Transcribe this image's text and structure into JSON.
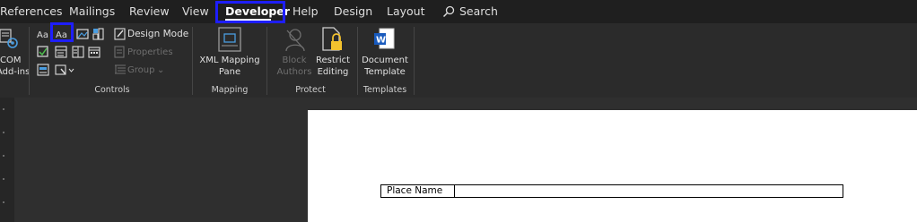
{
  "tabs": {
    "references": "References",
    "mailings": "Mailings",
    "review": "Review",
    "view": "View",
    "developer": "Developer",
    "help": "Help",
    "design": "Design",
    "layout": "Layout",
    "search": "Search"
  },
  "ribbon": {
    "addins": {
      "line1": "COM",
      "line2": "Add-ins"
    },
    "controls": {
      "design_mode": "Design Mode",
      "properties": "Properties",
      "group": "Group",
      "label": "Controls"
    },
    "mapping": {
      "line1": "XML Mapping",
      "line2": "Pane",
      "label": "Mapping"
    },
    "protect": {
      "block_line1": "Block",
      "block_line2": "Authors",
      "restrict_line1": "Restrict",
      "restrict_line2": "Editing",
      "label": "Protect"
    },
    "templates": {
      "line1": "Document",
      "line2": "Template",
      "label": "Templates"
    }
  },
  "document": {
    "table": {
      "label": "Place Name",
      "value": ""
    }
  },
  "colors": {
    "highlight": "#1e1eff",
    "word_blue": "#185abd"
  },
  "icons": [
    "com-addins-icon",
    "plain-text-control-icon",
    "rich-text-control-icon",
    "picture-control-icon",
    "building-block-control-icon",
    "checkbox-control-icon",
    "combo-box-control-icon",
    "dropdown-control-icon",
    "date-picker-control-icon",
    "legacy-tools-icon",
    "design-mode-icon",
    "properties-icon",
    "group-icon",
    "xml-mapping-icon",
    "block-authors-icon",
    "restrict-editing-icon",
    "word-document-icon",
    "search-icon"
  ]
}
